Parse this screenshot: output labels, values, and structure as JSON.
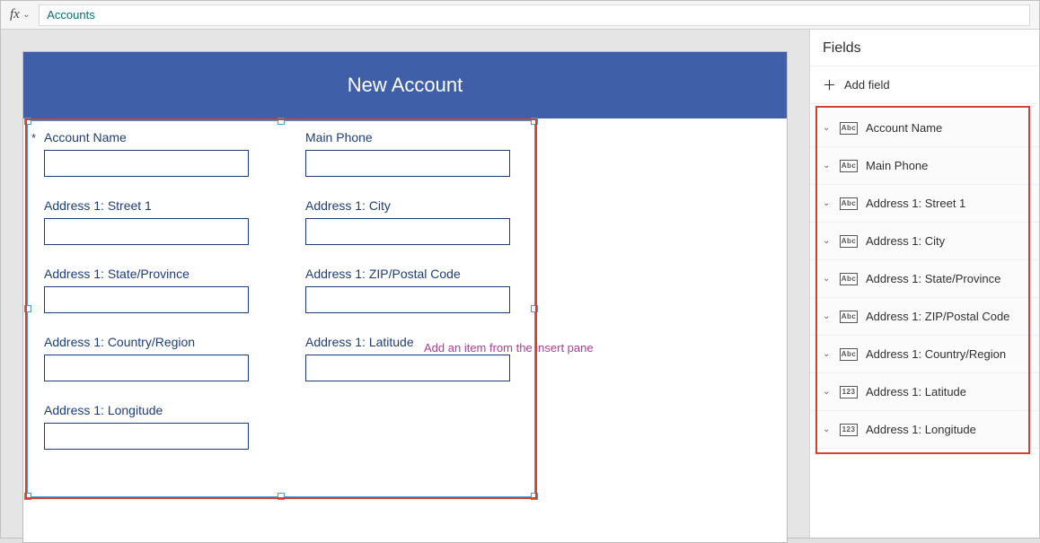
{
  "formula_bar": {
    "fx_label": "fx",
    "value": "Accounts"
  },
  "canvas": {
    "header_title": "New Account",
    "placeholder_hint": "Add an item from the insert pane",
    "required_mark": "*",
    "fields": [
      {
        "label": "Account Name",
        "required": true
      },
      {
        "label": "Main Phone"
      },
      {
        "label": "Address 1: Street 1"
      },
      {
        "label": "Address 1: City"
      },
      {
        "label": "Address 1: State/Province"
      },
      {
        "label": "Address 1: ZIP/Postal Code"
      },
      {
        "label": "Address 1: Country/Region"
      },
      {
        "label": "Address 1: Latitude"
      },
      {
        "label": "Address 1: Longitude"
      }
    ]
  },
  "fields_pane": {
    "title": "Fields",
    "add_field_label": "Add field",
    "type_abc": "Abc",
    "type_123": "123",
    "items": [
      {
        "label": "Account Name",
        "type": "Abc"
      },
      {
        "label": "Main Phone",
        "type": "Abc"
      },
      {
        "label": "Address 1: Street 1",
        "type": "Abc"
      },
      {
        "label": "Address 1: City",
        "type": "Abc"
      },
      {
        "label": "Address 1: State/Province",
        "type": "Abc"
      },
      {
        "label": "Address 1: ZIP/Postal Code",
        "type": "Abc"
      },
      {
        "label": "Address 1: Country/Region",
        "type": "Abc"
      },
      {
        "label": "Address 1: Latitude",
        "type": "123"
      },
      {
        "label": "Address 1: Longitude",
        "type": "123"
      }
    ]
  }
}
